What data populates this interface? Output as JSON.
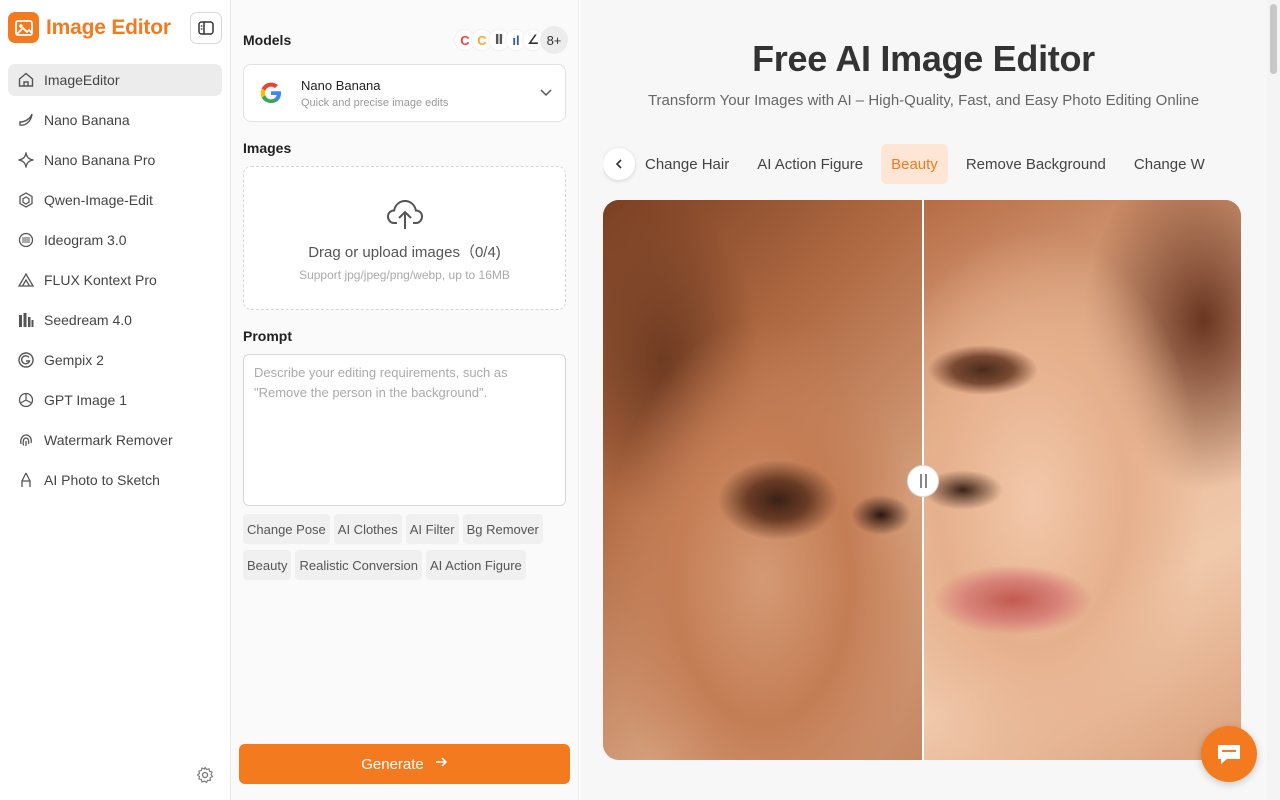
{
  "brand": {
    "name": "Image Editor"
  },
  "sidebar": {
    "items": [
      {
        "label": "ImageEditor",
        "icon": "home-icon",
        "active": true
      },
      {
        "label": "Nano Banana",
        "icon": "banana-icon"
      },
      {
        "label": "Nano Banana Pro",
        "icon": "sparkle-icon"
      },
      {
        "label": "Qwen-Image-Edit",
        "icon": "qwen-icon"
      },
      {
        "label": "Ideogram 3.0",
        "icon": "ideogram-icon"
      },
      {
        "label": "FLUX Kontext Pro",
        "icon": "flux-icon"
      },
      {
        "label": "Seedream 4.0",
        "icon": "bars-icon"
      },
      {
        "label": "Gempix 2",
        "icon": "gempix-icon"
      },
      {
        "label": "GPT Image 1",
        "icon": "openai-icon"
      },
      {
        "label": "Watermark Remover",
        "icon": "fingerprint-icon"
      },
      {
        "label": "AI Photo to Sketch",
        "icon": "pencil-icon"
      }
    ]
  },
  "panel": {
    "models_title": "Models",
    "models_more": "8+",
    "model": {
      "name": "Nano Banana",
      "description": "Quick and precise image edits"
    },
    "images_title": "Images",
    "upload_text": "Drag or upload images（0/4)",
    "upload_hint": "Support jpg/jpeg/png/webp, up to 16MB",
    "prompt_title": "Prompt",
    "prompt_placeholder": "Describe your editing requirements, such as \"Remove the person in the background\".",
    "chips": [
      "Change Pose",
      "AI Clothes",
      "AI Filter",
      "Bg Remover",
      "Beauty",
      "Realistic Conversion",
      "AI Action Figure"
    ],
    "generate_label": "Generate"
  },
  "main": {
    "title": "Free AI Image Editor",
    "subtitle": "Transform Your Images with AI – High-Quality, Fast, and Easy Photo Editing Online",
    "tabs": [
      {
        "label": "Change Hair"
      },
      {
        "label": "AI Action Figure"
      },
      {
        "label": "Beauty",
        "active": true
      },
      {
        "label": "Remove Background"
      },
      {
        "label": "Change W"
      }
    ]
  },
  "colors": {
    "accent": "#f47a1f",
    "active_tab_bg": "#fde6d5"
  }
}
